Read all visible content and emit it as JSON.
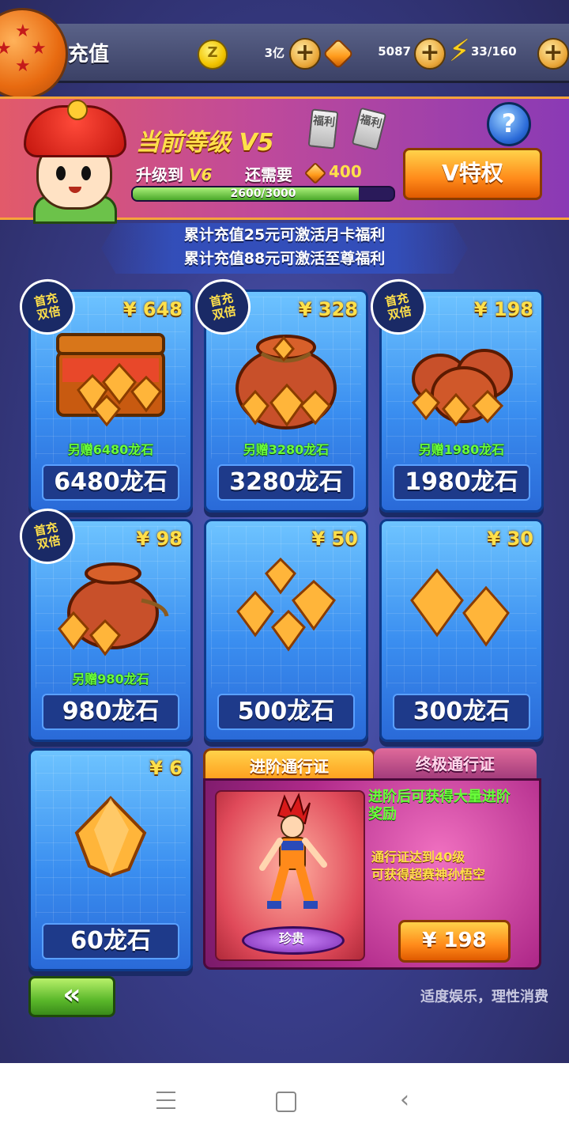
{
  "topbar": {
    "title": "充值",
    "gold": "3亿",
    "gems": "5087",
    "stamina": "33/160",
    "coin_symbol": "Z"
  },
  "vip": {
    "current_level": "当前等级 V5",
    "upgrade_label": "升级到",
    "next_level": "V6",
    "need_label": "还需要",
    "need_value": "400",
    "progress_text": "2600/3000",
    "progress": 0.8667,
    "tag_label": "福利",
    "help_label": "?",
    "privilege_label": "V特权"
  },
  "notice": {
    "line1": "累计充值25元可激活月卡福利",
    "line2": "累计充值88元可激活至尊福利"
  },
  "badge": {
    "line1": "首充",
    "line2": "双倍"
  },
  "packs": [
    {
      "price": "¥ 648",
      "bonus": "另赠6480龙石",
      "amount": "6480龙石"
    },
    {
      "price": "¥ 328",
      "bonus": "另赠3280龙石",
      "amount": "3280龙石"
    },
    {
      "price": "¥ 198",
      "bonus": "另赠1980龙石",
      "amount": "1980龙石"
    },
    {
      "price": "¥ 98",
      "bonus": "另赠980龙石",
      "amount": "980龙石"
    },
    {
      "price": "¥ 50",
      "amount": "500龙石"
    },
    {
      "price": "¥ 30",
      "amount": "300龙石"
    },
    {
      "price": "¥ 6",
      "amount": "60龙石"
    }
  ],
  "pass": {
    "tab_advanced": "进阶通行证",
    "tab_ultimate": "终极通行证",
    "desc1": "进阶后可获得大量进阶奖励",
    "desc2_line1": "通行证达到40级",
    "desc2_line2": "可获得超赛神孙悟空",
    "rarity": "珍贵",
    "price": "¥ 198"
  },
  "footer": {
    "back_label": "«",
    "slogan": "适度娱乐，理性消费"
  },
  "colors": {
    "accent": "#ffe04a",
    "bonus": "#6aff3a",
    "card": "#3a8ef0"
  }
}
